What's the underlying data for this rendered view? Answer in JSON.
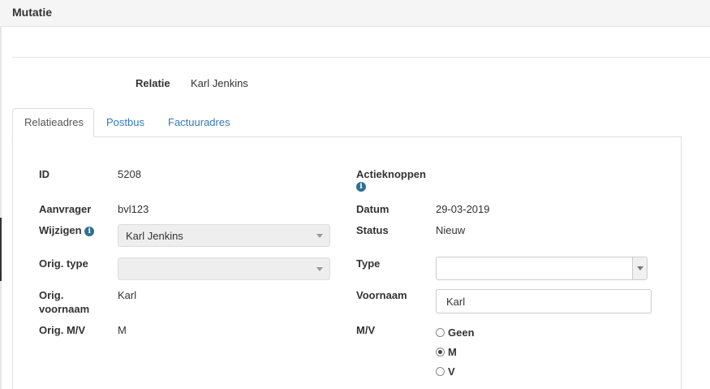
{
  "header": {
    "title": "Mutatie"
  },
  "relation": {
    "label": "Relatie",
    "value": "Karl Jenkins"
  },
  "tabs": [
    {
      "label": "Relatieadres",
      "active": true
    },
    {
      "label": "Postbus",
      "active": false
    },
    {
      "label": "Factuuradres",
      "active": false
    }
  ],
  "form": {
    "id": {
      "label": "ID",
      "value": "5208"
    },
    "aanvrager": {
      "label": "Aanvrager",
      "value": "bvl123"
    },
    "wijzigen": {
      "label": "Wijzigen",
      "value": "Karl Jenkins"
    },
    "orig_type": {
      "label": "Orig. type",
      "value": ""
    },
    "orig_voornaam": {
      "label_line1": "Orig.",
      "label_line2": "voornaam",
      "value": "Karl"
    },
    "orig_mv": {
      "label": "Orig. M/V",
      "value": "M"
    },
    "actieknoppen": {
      "label": "Actieknoppen"
    },
    "datum": {
      "label": "Datum",
      "value": "29-03-2019"
    },
    "status": {
      "label": "Status",
      "value": "Nieuw"
    },
    "type": {
      "label": "Type",
      "value": ""
    },
    "voornaam": {
      "label": "Voornaam",
      "value": "Karl"
    },
    "mv": {
      "label": "M/V",
      "options": [
        {
          "label": "Geen",
          "checked": false
        },
        {
          "label": "M",
          "checked": true
        },
        {
          "label": "V",
          "checked": false
        }
      ]
    }
  },
  "colors": {
    "link": "#337ab7",
    "info_icon": "#31708f"
  }
}
